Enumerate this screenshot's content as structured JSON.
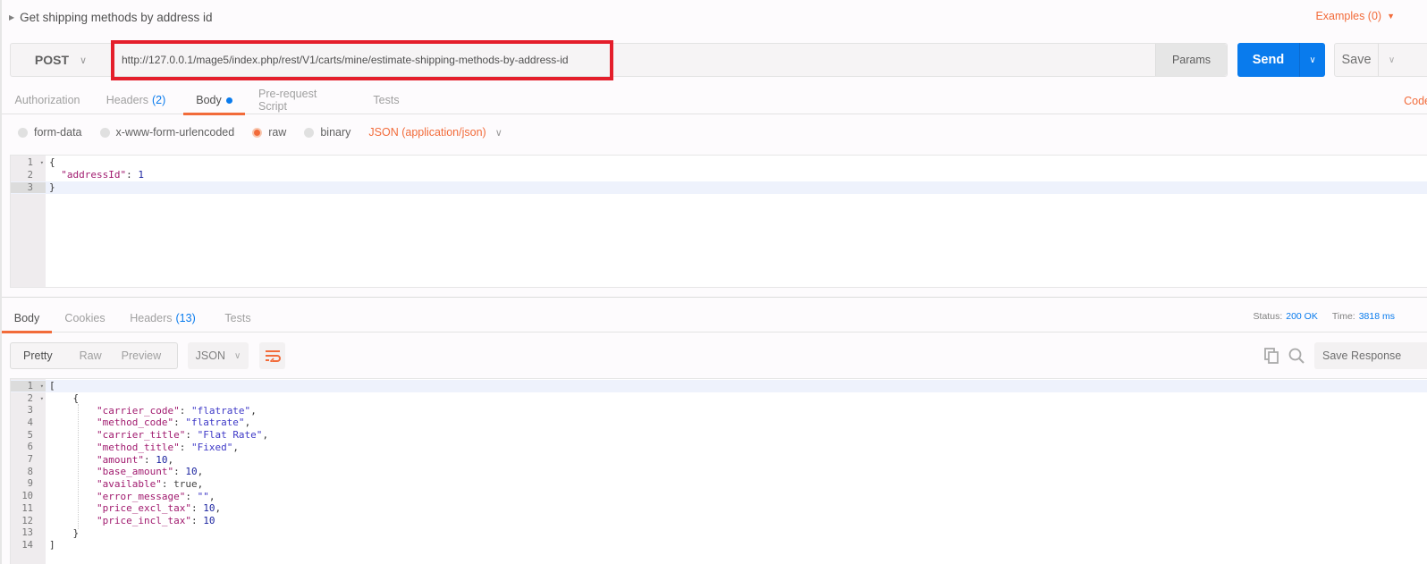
{
  "request": {
    "title": "Get shipping methods by address id",
    "examples_label": "Examples (0)",
    "method": "POST",
    "url": "http://127.0.0.1/mage5/index.php/rest/V1/carts/mine/estimate-shipping-methods-by-address-id",
    "params_label": "Params",
    "send_label": "Send",
    "save_label": "Save",
    "code_label": "Code",
    "tabs": [
      {
        "label": "Authorization"
      },
      {
        "label": "Headers",
        "count": "(2)"
      },
      {
        "label": "Body",
        "active": true,
        "modified": true
      },
      {
        "label": "Pre-request Script"
      },
      {
        "label": "Tests"
      }
    ],
    "body_modes": [
      {
        "label": "form-data",
        "selected": false
      },
      {
        "label": "x-www-form-urlencoded",
        "selected": false
      },
      {
        "label": "raw",
        "selected": true
      },
      {
        "label": "binary",
        "selected": false
      }
    ],
    "content_type": "JSON (application/json)",
    "body_lines": [
      {
        "n": "1",
        "fold": true,
        "code": "{"
      },
      {
        "n": "2",
        "key": "\"addressId\"",
        "value": "1"
      },
      {
        "n": "3",
        "code": "}"
      }
    ]
  },
  "response": {
    "tabs": [
      {
        "label": "Body",
        "active": true
      },
      {
        "label": "Cookies"
      },
      {
        "label": "Headers",
        "count": "(13)"
      },
      {
        "label": "Tests"
      }
    ],
    "status_label": "Status:",
    "status_value": "200 OK",
    "time_label": "Time:",
    "time_value": "3818 ms",
    "view_modes": [
      "Pretty",
      "Raw",
      "Preview"
    ],
    "active_view": "Pretty",
    "format": "JSON",
    "save_response_label": "Save Response",
    "icons": {
      "wrap": "wrap-lines-icon",
      "copy": "copy-icon",
      "search": "search-icon"
    },
    "body_lines": [
      {
        "n": "1",
        "fold": true,
        "indent": 0,
        "code": "["
      },
      {
        "n": "2",
        "fold": true,
        "indent": 1,
        "code": "{"
      },
      {
        "n": "3",
        "indent": 2,
        "key": "\"carrier_code\"",
        "str": "\"flatrate\"",
        "comma": true
      },
      {
        "n": "4",
        "indent": 2,
        "key": "\"method_code\"",
        "str": "\"flatrate\"",
        "comma": true
      },
      {
        "n": "5",
        "indent": 2,
        "key": "\"carrier_title\"",
        "str": "\"Flat Rate\"",
        "comma": true
      },
      {
        "n": "6",
        "indent": 2,
        "key": "\"method_title\"",
        "str": "\"Fixed\"",
        "comma": true
      },
      {
        "n": "7",
        "indent": 2,
        "key": "\"amount\"",
        "num": "10",
        "comma": true
      },
      {
        "n": "8",
        "indent": 2,
        "key": "\"base_amount\"",
        "num": "10",
        "comma": true
      },
      {
        "n": "9",
        "indent": 2,
        "key": "\"available\"",
        "bool": "true",
        "comma": true
      },
      {
        "n": "10",
        "indent": 2,
        "key": "\"error_message\"",
        "str": "\"\"",
        "comma": true
      },
      {
        "n": "11",
        "indent": 2,
        "key": "\"price_excl_tax\"",
        "num": "10",
        "comma": true
      },
      {
        "n": "12",
        "indent": 2,
        "key": "\"price_incl_tax\"",
        "num": "10",
        "comma": false
      },
      {
        "n": "13",
        "indent": 1,
        "code": "}"
      },
      {
        "n": "14",
        "indent": 0,
        "code": "]"
      }
    ]
  },
  "colors": {
    "accent": "#f26b3a",
    "primary": "#097bed",
    "highlight_box": "#e41e2b"
  }
}
